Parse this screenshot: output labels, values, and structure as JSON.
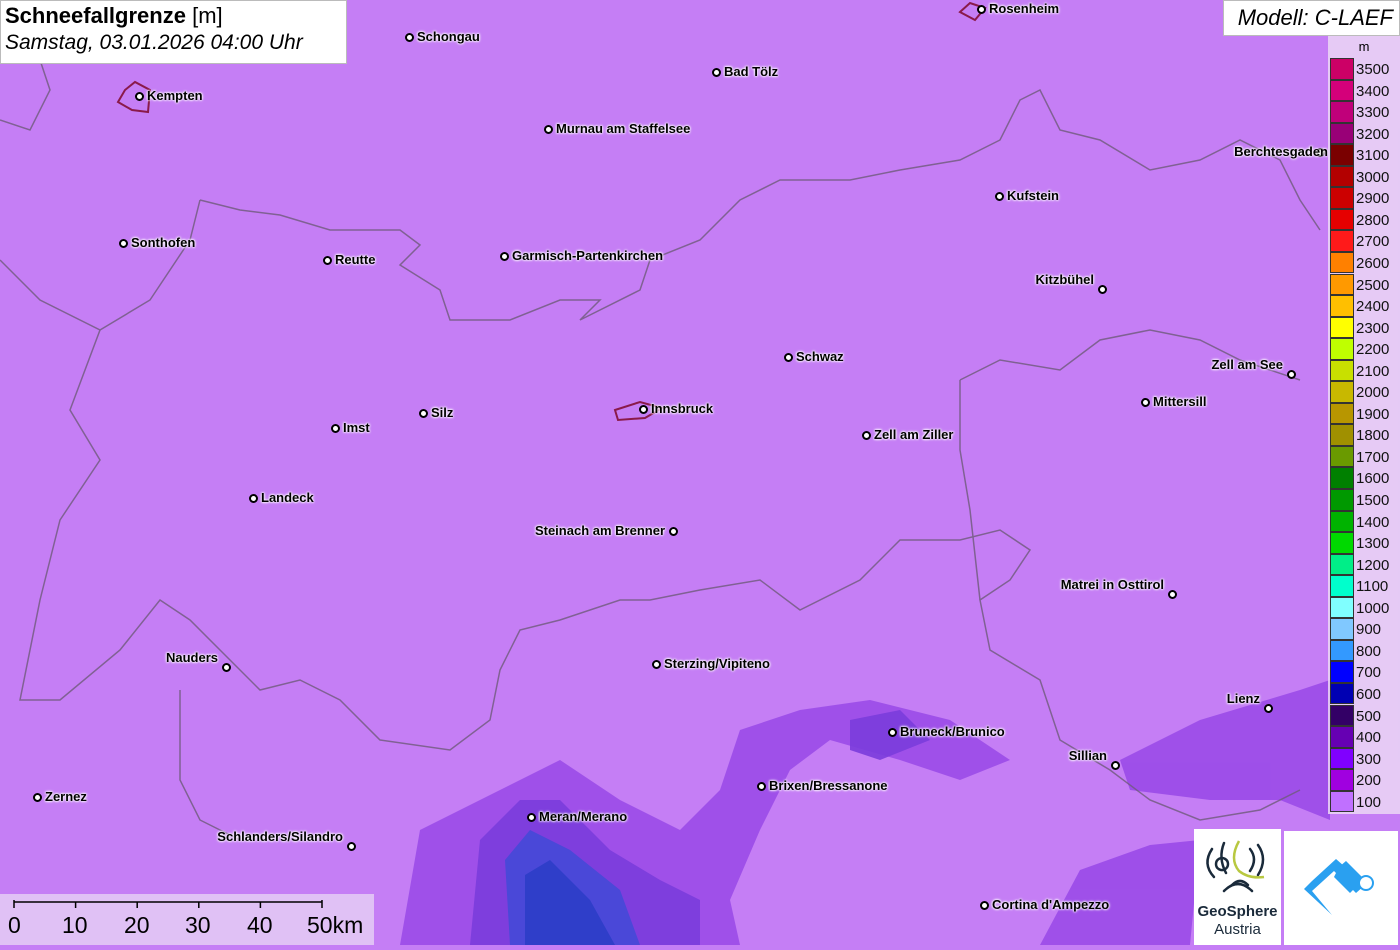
{
  "title": {
    "main": "Schneefallgrenze",
    "unit": "[m]",
    "datetime": "Samstag, 03.01.2026 04:00 Uhr"
  },
  "model": "Modell: C-LAEF",
  "legend": {
    "unit": "m",
    "entries": [
      {
        "label": "3500",
        "color": "#cc0066"
      },
      {
        "label": "3400",
        "color": "#d4007a"
      },
      {
        "label": "3300",
        "color": "#c0007a"
      },
      {
        "label": "3200",
        "color": "#990077"
      },
      {
        "label": "3100",
        "color": "#7a0000"
      },
      {
        "label": "3000",
        "color": "#b30000"
      },
      {
        "label": "2900",
        "color": "#cc0000"
      },
      {
        "label": "2800",
        "color": "#e60000"
      },
      {
        "label": "2700",
        "color": "#ff1a1a"
      },
      {
        "label": "2600",
        "color": "#ff8000"
      },
      {
        "label": "2500",
        "color": "#ff9900"
      },
      {
        "label": "2400",
        "color": "#ffbf00"
      },
      {
        "label": "2300",
        "color": "#ffff00"
      },
      {
        "label": "2200",
        "color": "#bfff00"
      },
      {
        "label": "2100",
        "color": "#c8e000"
      },
      {
        "label": "2000",
        "color": "#c8b800"
      },
      {
        "label": "1900",
        "color": "#b89600"
      },
      {
        "label": "1800",
        "color": "#a09000"
      },
      {
        "label": "1700",
        "color": "#6a9a00"
      },
      {
        "label": "1600",
        "color": "#008000"
      },
      {
        "label": "1500",
        "color": "#009900"
      },
      {
        "label": "1400",
        "color": "#00b300"
      },
      {
        "label": "1300",
        "color": "#00d900"
      },
      {
        "label": "1200",
        "color": "#00ee88"
      },
      {
        "label": "1100",
        "color": "#00ffcc"
      },
      {
        "label": "1000",
        "color": "#80ffff"
      },
      {
        "label": "900",
        "color": "#80c8ff"
      },
      {
        "label": "800",
        "color": "#3399ff"
      },
      {
        "label": "700",
        "color": "#0000ff"
      },
      {
        "label": "600",
        "color": "#0000b3"
      },
      {
        "label": "500",
        "color": "#330066"
      },
      {
        "label": "400",
        "color": "#6600b3"
      },
      {
        "label": "300",
        "color": "#8000ff"
      },
      {
        "label": "200",
        "color": "#a000e0"
      },
      {
        "label": "100",
        "color": "#c070ff"
      }
    ]
  },
  "cities": [
    "Rosenheim",
    "Schongau",
    "Bad Tölz",
    "Kempten",
    "Murnau am Staffelsee",
    "Berchtesgaden",
    "Kufstein",
    "Sonthofen",
    "Reutte",
    "Garmisch-Partenkirchen",
    "Kitzbühel",
    "Schwaz",
    "Zell am See",
    "Mittersill",
    "Silz",
    "Innsbruck",
    "Imst",
    "Zell am Ziller",
    "Landeck",
    "Steinach am Brenner",
    "Matrei in Osttirol",
    "Nauders",
    "Sterzing/Vipiteno",
    "Lienz",
    "Bruneck/Brunico",
    "Sillian",
    "Brixen/Bressanone",
    "Zernez",
    "Meran/Merano",
    "Schlanders/Silandro",
    "Cortina d'Ampezzo"
  ],
  "scalebar": [
    "0",
    "10",
    "20",
    "30",
    "40",
    "50km"
  ],
  "logos": {
    "geosphere_line1": "GeoSphere",
    "geosphere_line2": "Austria"
  }
}
